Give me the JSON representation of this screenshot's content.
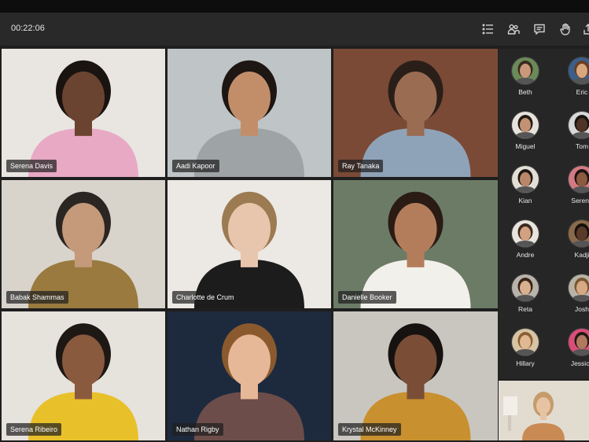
{
  "meeting": {
    "timer": "00:22:06"
  },
  "toolbar": {
    "icons": [
      "list-icon",
      "people-icon",
      "chat-icon",
      "raise-hand-icon",
      "share-icon"
    ]
  },
  "participants_grid": [
    {
      "name": "Serena Davis",
      "bg": "#e9e6e1",
      "skin": "#6b4431",
      "hair": "#1a1410",
      "shirt": "#e8a9c4"
    },
    {
      "name": "Aadi Kapoor",
      "bg": "#bfc4c6",
      "skin": "#c28e6a",
      "hair": "#1e1612",
      "shirt": "#9ea3a5"
    },
    {
      "name": "Ray Tanaka",
      "bg": "#7a4a36",
      "skin": "#9a6c52",
      "hair": "#2a1f18",
      "shirt": "#8fa3b8"
    },
    {
      "name": "Babak Shammas",
      "bg": "#d8d4cc",
      "skin": "#c49a7a",
      "hair": "#2b2622",
      "shirt": "#9a7a3e"
    },
    {
      "name": "Charlotte de Crum",
      "bg": "#ece9e4",
      "skin": "#e8c6ad",
      "hair": "#9c7a52",
      "shirt": "#1c1c1c"
    },
    {
      "name": "Danielle Booker",
      "bg": "#6c7b66",
      "skin": "#b37d5c",
      "hair": "#2a1b14",
      "shirt": "#f2f0ea"
    },
    {
      "name": "Serena Ribeiro",
      "bg": "#e6e2dc",
      "skin": "#8a5a3e",
      "hair": "#1d1814",
      "shirt": "#e8c02a"
    },
    {
      "name": "Nathan Rigby",
      "bg": "#1d2a3e",
      "skin": "#e6b897",
      "hair": "#8a5a2e",
      "shirt": "#6d4d4a"
    },
    {
      "name": "Krystal McKinney",
      "bg": "#c9c6c0",
      "skin": "#7a4e36",
      "hair": "#161210",
      "shirt": "#c8902e"
    }
  ],
  "roster": [
    {
      "name": "Beth",
      "skin": "#c9987a",
      "hair": "#3a2a1e",
      "bg": "#6b8a5a"
    },
    {
      "name": "Eric",
      "skin": "#d9a77e",
      "hair": "#6a3e22",
      "bg": "#3b5f8c"
    },
    {
      "name": "Miguel",
      "skin": "#c49174",
      "hair": "#221a14",
      "bg": "#e7e3dc"
    },
    {
      "name": "Tom",
      "skin": "#4f3426",
      "hair": "#1a1410",
      "bg": "#d8d8d8"
    },
    {
      "name": "Kian",
      "skin": "#b8876a",
      "hair": "#1e1712",
      "bg": "#e3ded6"
    },
    {
      "name": "Serena",
      "skin": "#8c5a3e",
      "hair": "#1b1410",
      "bg": "#d27a84"
    },
    {
      "name": "Andre",
      "skin": "#d2a280",
      "hair": "#3a2a1e",
      "bg": "#e9e5de"
    },
    {
      "name": "Kadji",
      "skin": "#5a3a2a",
      "hair": "#15110e",
      "bg": "#8a6a4a"
    },
    {
      "name": "Reta",
      "skin": "#d8b090",
      "hair": "#3a2416",
      "bg": "#b8b4ac"
    },
    {
      "name": "Josh",
      "skin": "#d7a985",
      "hair": "#7a5632",
      "bg": "#b9b2a6"
    },
    {
      "name": "Hillary",
      "skin": "#e0b892",
      "hair": "#8a5f34",
      "bg": "#d7c4a4"
    },
    {
      "name": "Jessica",
      "skin": "#b07a5e",
      "hair": "#241914",
      "bg": "#d94e78"
    }
  ],
  "self_view": {
    "skin": "#e7c3a4",
    "hair": "#c49b6a",
    "shirt": "#c98a54",
    "bg": "#e2dbd0"
  },
  "colors": {
    "topbar": "#292929",
    "tag_bg": "#1e1e1e"
  }
}
